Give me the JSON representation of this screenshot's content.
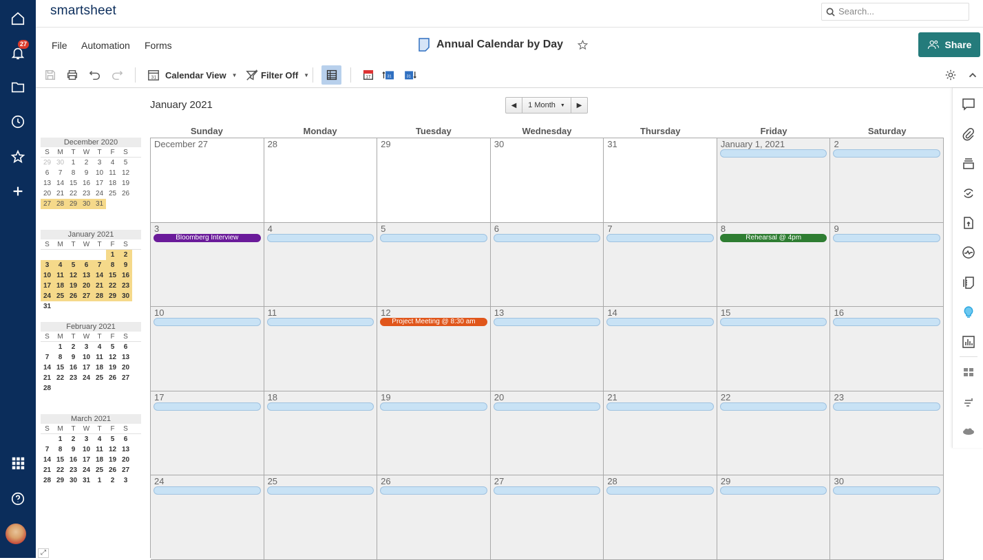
{
  "app": {
    "logo": "smartsheet",
    "notifications_count": "27"
  },
  "search": {
    "placeholder": "Search..."
  },
  "menu": {
    "file": "File",
    "automation": "Automation",
    "forms": "Forms"
  },
  "sheet": {
    "title": "Annual Calendar by Day"
  },
  "share": {
    "label": "Share"
  },
  "toolbar": {
    "view_label": "Calendar View",
    "filter_label": "Filter Off"
  },
  "calendar": {
    "title": "January 2021",
    "range_label": "1 Month",
    "days": [
      "Sunday",
      "Monday",
      "Tuesday",
      "Wednesday",
      "Thursday",
      "Friday",
      "Saturday"
    ],
    "weeks": [
      [
        {
          "d": "December 27",
          "w": true
        },
        {
          "d": "28",
          "w": true
        },
        {
          "d": "29",
          "w": true
        },
        {
          "d": "30",
          "w": true
        },
        {
          "d": "31",
          "w": true
        },
        {
          "d": "January 1, 2021",
          "bar": true
        },
        {
          "d": "2",
          "bar": true
        }
      ],
      [
        {
          "d": "3",
          "bar": true,
          "event": "Bloomberg Interview",
          "color": "#6a1b9a"
        },
        {
          "d": "4",
          "bar": true
        },
        {
          "d": "5",
          "bar": true
        },
        {
          "d": "6",
          "bar": true
        },
        {
          "d": "7",
          "bar": true
        },
        {
          "d": "8",
          "bar": true,
          "event": "Rehearsal @ 4pm",
          "color": "#2e7d32"
        },
        {
          "d": "9",
          "bar": true
        }
      ],
      [
        {
          "d": "10",
          "bar": true
        },
        {
          "d": "11",
          "bar": true
        },
        {
          "d": "12",
          "bar": true,
          "event": "Project Meeting @ 8:30 am",
          "color": "#e0561b"
        },
        {
          "d": "13",
          "bar": true
        },
        {
          "d": "14",
          "bar": true
        },
        {
          "d": "15",
          "bar": true
        },
        {
          "d": "16",
          "bar": true
        }
      ],
      [
        {
          "d": "17",
          "bar": true
        },
        {
          "d": "18",
          "bar": true
        },
        {
          "d": "19",
          "bar": true
        },
        {
          "d": "20",
          "bar": true
        },
        {
          "d": "21",
          "bar": true
        },
        {
          "d": "22",
          "bar": true
        },
        {
          "d": "23",
          "bar": true
        }
      ],
      [
        {
          "d": "24",
          "bar": true
        },
        {
          "d": "25",
          "bar": true
        },
        {
          "d": "26",
          "bar": true
        },
        {
          "d": "27",
          "bar": true
        },
        {
          "d": "28",
          "bar": true
        },
        {
          "d": "29",
          "bar": true
        },
        {
          "d": "30",
          "bar": true
        }
      ]
    ]
  },
  "mini_calendars": [
    {
      "title": "December 2020",
      "bold": false,
      "rows": [
        [
          "29",
          "30",
          "1",
          "2",
          "3",
          "4",
          "5"
        ],
        [
          "6",
          "7",
          "8",
          "9",
          "10",
          "11",
          "12"
        ],
        [
          "13",
          "14",
          "15",
          "16",
          "17",
          "18",
          "19"
        ],
        [
          "20",
          "21",
          "22",
          "23",
          "24",
          "25",
          "26"
        ],
        [
          "27",
          "28",
          "29",
          "30",
          "31",
          "",
          ""
        ]
      ],
      "out": [
        [
          0,
          0
        ],
        [
          0,
          1
        ]
      ],
      "hl": [
        [
          4,
          0
        ],
        [
          4,
          1
        ],
        [
          4,
          2
        ],
        [
          4,
          3
        ],
        [
          4,
          4
        ]
      ]
    },
    {
      "title": "January 2021",
      "bold": true,
      "rows": [
        [
          "",
          "",
          "",
          "",
          "",
          "1",
          "2"
        ],
        [
          "3",
          "4",
          "5",
          "6",
          "7",
          "8",
          "9"
        ],
        [
          "10",
          "11",
          "12",
          "13",
          "14",
          "15",
          "16"
        ],
        [
          "17",
          "18",
          "19",
          "20",
          "21",
          "22",
          "23"
        ],
        [
          "24",
          "25",
          "26",
          "27",
          "28",
          "29",
          "30"
        ],
        [
          "31",
          "",
          "",
          "",
          "",
          "",
          ""
        ]
      ],
      "hlrows": [
        1,
        2,
        3,
        4
      ],
      "hl": [
        [
          0,
          5
        ],
        [
          0,
          6
        ]
      ]
    },
    {
      "title": "February 2021",
      "bold": true,
      "rows": [
        [
          "",
          "1",
          "2",
          "3",
          "4",
          "5",
          "6"
        ],
        [
          "7",
          "8",
          "9",
          "10",
          "11",
          "12",
          "13"
        ],
        [
          "14",
          "15",
          "16",
          "17",
          "18",
          "19",
          "20"
        ],
        [
          "21",
          "22",
          "23",
          "24",
          "25",
          "26",
          "27"
        ],
        [
          "28",
          "",
          "",
          "",
          "",
          "",
          ""
        ]
      ]
    },
    {
      "title": "March 2021",
      "bold": true,
      "rows": [
        [
          "",
          "1",
          "2",
          "3",
          "4",
          "5",
          "6"
        ],
        [
          "7",
          "8",
          "9",
          "10",
          "11",
          "12",
          "13"
        ],
        [
          "14",
          "15",
          "16",
          "17",
          "18",
          "19",
          "20"
        ],
        [
          "21",
          "22",
          "23",
          "24",
          "25",
          "26",
          "27"
        ],
        [
          "28",
          "29",
          "30",
          "31",
          "1",
          "2",
          "3"
        ]
      ]
    }
  ],
  "dow_short": [
    "S",
    "M",
    "T",
    "W",
    "T",
    "F",
    "S"
  ]
}
